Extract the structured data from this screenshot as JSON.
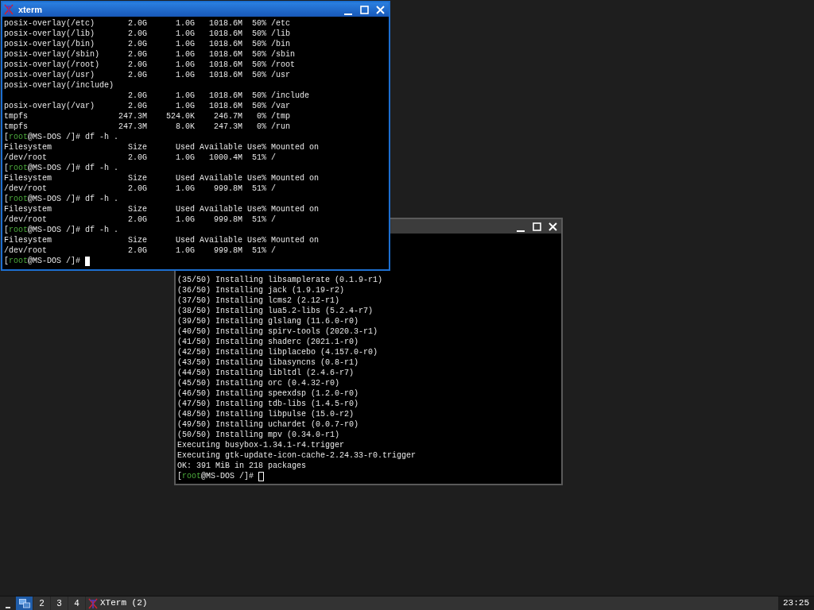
{
  "windows": [
    {
      "active": false,
      "lines": [
        {
          "kind": "output",
          "text": "(35/50) Installing libsamplerate (0.1.9-r1)"
        },
        {
          "kind": "output",
          "text": "(36/50) Installing jack (1.9.19-r2)"
        },
        {
          "kind": "output",
          "text": "(37/50) Installing lcms2 (2.12-r1)"
        },
        {
          "kind": "output",
          "text": "(38/50) Installing lua5.2-libs (5.2.4-r7)"
        },
        {
          "kind": "output",
          "text": "(39/50) Installing glslang (11.6.0-r0)"
        },
        {
          "kind": "output",
          "text": "(40/50) Installing spirv-tools (2020.3-r1)"
        },
        {
          "kind": "output",
          "text": "(41/50) Installing shaderc (2021.1-r0)"
        },
        {
          "kind": "output",
          "text": "(42/50) Installing libplacebo (4.157.0-r0)"
        },
        {
          "kind": "output",
          "text": "(43/50) Installing libasyncns (0.8-r1)"
        },
        {
          "kind": "output",
          "text": "(44/50) Installing libltdl (2.4.6-r7)"
        },
        {
          "kind": "output",
          "text": "(45/50) Installing orc (0.4.32-r0)"
        },
        {
          "kind": "output",
          "text": "(46/50) Installing speexdsp (1.2.0-r0)"
        },
        {
          "kind": "output",
          "text": "(47/50) Installing tdb-libs (1.4.5-r0)"
        },
        {
          "kind": "output",
          "text": "(48/50) Installing libpulse (15.0-r2)"
        },
        {
          "kind": "output",
          "text": "(49/50) Installing uchardet (0.0.7-r0)"
        },
        {
          "kind": "output",
          "text": "(50/50) Installing mpv (0.34.0-r1)"
        },
        {
          "kind": "output",
          "text": "Executing busybox-1.34.1-r4.trigger"
        },
        {
          "kind": "output",
          "text": "Executing gtk-update-icon-cache-2.24.33-r0.trigger"
        },
        {
          "kind": "output",
          "text": "OK: 391 MiB in 218 packages"
        },
        {
          "kind": "prompt",
          "before": "[",
          "user": "root",
          "after": "@MS-DOS /]# ",
          "cursor": true
        }
      ]
    },
    {
      "active": true,
      "title": "xterm",
      "lines": [
        {
          "kind": "output",
          "text": "posix-overlay(/etc)       2.0G      1.0G   1018.6M  50% /etc"
        },
        {
          "kind": "output",
          "text": "posix-overlay(/lib)       2.0G      1.0G   1018.6M  50% /lib"
        },
        {
          "kind": "output",
          "text": "posix-overlay(/bin)       2.0G      1.0G   1018.6M  50% /bin"
        },
        {
          "kind": "output",
          "text": "posix-overlay(/sbin)      2.0G      1.0G   1018.6M  50% /sbin"
        },
        {
          "kind": "output",
          "text": "posix-overlay(/root)      2.0G      1.0G   1018.6M  50% /root"
        },
        {
          "kind": "output",
          "text": "posix-overlay(/usr)       2.0G      1.0G   1018.6M  50% /usr"
        },
        {
          "kind": "output",
          "text": "posix-overlay(/include)"
        },
        {
          "kind": "output",
          "text": "                          2.0G      1.0G   1018.6M  50% /include"
        },
        {
          "kind": "output",
          "text": "posix-overlay(/var)       2.0G      1.0G   1018.6M  50% /var"
        },
        {
          "kind": "output",
          "text": "tmpfs                   247.3M    524.0K    246.7M   0% /tmp"
        },
        {
          "kind": "output",
          "text": "tmpfs                   247.3M      8.0K    247.3M   0% /run"
        },
        {
          "kind": "prompt",
          "before": "[",
          "user": "root",
          "after": "@MS-DOS /]# ",
          "command": "df -h .",
          "cursor": false
        },
        {
          "kind": "output",
          "text": "Filesystem                Size      Used Available Use% Mounted on"
        },
        {
          "kind": "output",
          "text": "/dev/root                 2.0G      1.0G   1000.4M  51% /"
        },
        {
          "kind": "prompt",
          "before": "[",
          "user": "root",
          "after": "@MS-DOS /]# ",
          "command": "df -h .",
          "cursor": false
        },
        {
          "kind": "output",
          "text": "Filesystem                Size      Used Available Use% Mounted on"
        },
        {
          "kind": "output",
          "text": "/dev/root                 2.0G      1.0G    999.8M  51% /"
        },
        {
          "kind": "prompt",
          "before": "[",
          "user": "root",
          "after": "@MS-DOS /]# ",
          "command": "df -h .",
          "cursor": false
        },
        {
          "kind": "output",
          "text": "Filesystem                Size      Used Available Use% Mounted on"
        },
        {
          "kind": "output",
          "text": "/dev/root                 2.0G      1.0G    999.8M  51% /"
        },
        {
          "kind": "prompt",
          "before": "[",
          "user": "root",
          "after": "@MS-DOS /]# ",
          "command": "df -h .",
          "cursor": false
        },
        {
          "kind": "output",
          "text": "Filesystem                Size      Used Available Use% Mounted on"
        },
        {
          "kind": "output",
          "text": "/dev/root                 2.0G      1.0G    999.8M  51% /"
        },
        {
          "kind": "prompt",
          "before": "[",
          "user": "root",
          "after": "@MS-DOS /]# ",
          "cursor": true
        }
      ]
    }
  ],
  "taskbar": {
    "workspaces": [
      {
        "kind": "icon",
        "selected": true
      },
      {
        "kind": "number",
        "label": "2",
        "selected": false
      },
      {
        "kind": "number",
        "label": "3",
        "selected": false
      },
      {
        "kind": "number",
        "label": "4",
        "selected": false
      }
    ],
    "task": {
      "label": "XTerm (2)"
    },
    "clock": "23:25"
  }
}
